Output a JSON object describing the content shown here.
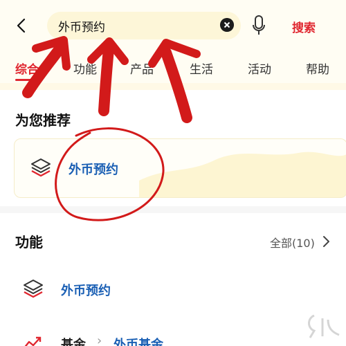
{
  "header": {
    "search_value": "外币预约",
    "search_button_label": "搜索"
  },
  "tabs": [
    {
      "label": "综合",
      "active": true
    },
    {
      "label": "功能",
      "active": false
    },
    {
      "label": "产品",
      "active": false
    },
    {
      "label": "生活",
      "active": false
    },
    {
      "label": "活动",
      "active": false
    },
    {
      "label": "帮助",
      "active": false
    }
  ],
  "recommend": {
    "title": "为您推荐",
    "item_label": "外币预约",
    "item_icon": "layers-icon"
  },
  "functions": {
    "title": "功能",
    "all_label": "全部(10)",
    "items": [
      {
        "label": "外币预约",
        "icon": "layers-icon"
      }
    ],
    "partial_row": {
      "part_a": "基金",
      "separator": "›",
      "part_b": "外币基金",
      "icon": "chart-trend-icon"
    }
  },
  "colors": {
    "accent_red": "#e0262f",
    "link_blue": "#1a5fb4",
    "annotation_red": "#d21a1a",
    "tab_background": "#fffdf3"
  }
}
